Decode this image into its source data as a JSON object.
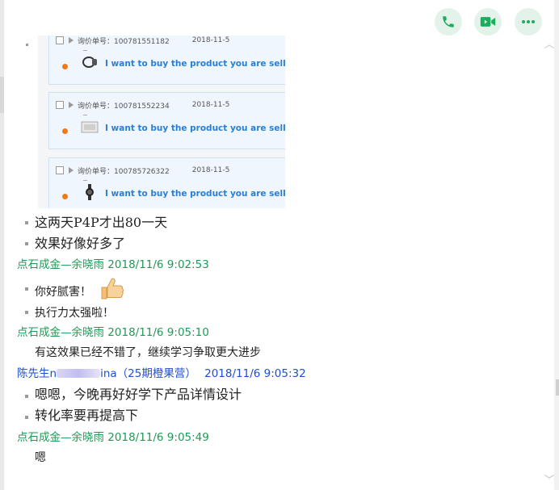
{
  "toolbar": {
    "icons": [
      "phone-icon",
      "video-call-icon",
      "more-icon"
    ],
    "accent_color": "#1aad5c"
  },
  "embedded_screenshot": {
    "cards": [
      {
        "inquiry_label": "询价单号：100781551182",
        "date": "2018-11-5",
        "product_text": "I want to buy the product you are selling on A"
      },
      {
        "inquiry_label": "询价单号：100781552234",
        "date": "2018-11-5",
        "product_text": "I want to buy the product you are selling on A"
      },
      {
        "inquiry_label": "询价单号：100785726322",
        "date": "2018-11-5",
        "product_text": "I want to buy the product you are selling on A"
      }
    ]
  },
  "messages": [
    {
      "lines": [
        "这两天P4P才出80一天",
        "效果好像好多了"
      ]
    },
    {
      "sender": "点石成金—余晓雨",
      "time": "2018/11/6 9:02:53",
      "lines": [
        "你好腻害！",
        "执行力太强啦！"
      ],
      "emoji": "thumbs-up-icon"
    },
    {
      "sender": "点石成金—余晓雨",
      "time": "2018/11/6 9:05:10",
      "lines": [
        "有这效果已经不错了，继续学习争取更大进步"
      ]
    },
    {
      "sender_prefix": "陈先生",
      "sender_visible_a": "n",
      "sender_suffix": "ina（25期橙果营）",
      "time": "2018/11/6 9:05:32",
      "lines": [
        "嗯嗯，今晚再好好学下产品详情设计",
        "转化率要再提高下"
      ]
    },
    {
      "sender": "点石成金—余晓雨",
      "time": "2018/11/6 9:05:49",
      "lines": [
        "嗯"
      ]
    }
  ]
}
